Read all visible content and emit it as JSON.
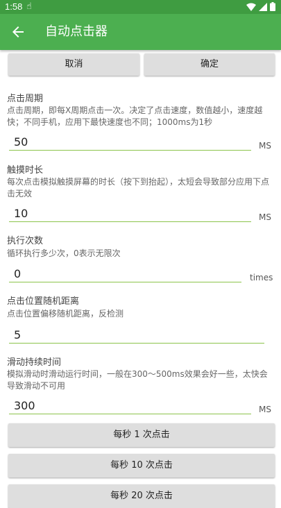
{
  "status": {
    "time": "1:58"
  },
  "appbar": {
    "title": "自动点击器"
  },
  "actions": {
    "cancel": "取消",
    "confirm": "确定"
  },
  "settings": [
    {
      "label": "点击周期",
      "desc": "点击周期，即每X周期点击一次。决定了点击速度，数值越小，速度越快；不同手机，应用下最快速度也不同；1000ms为1秒",
      "value": "50",
      "unit": "MS"
    },
    {
      "label": "触摸时长",
      "desc": "每次点击模拟触摸屏幕的时长（按下到抬起），太短会导致部分应用下点击无效",
      "value": "10",
      "unit": "MS"
    },
    {
      "label": "执行次数",
      "desc": "循环执行多少次，0表示无限次",
      "value": "0",
      "unit": "times"
    },
    {
      "label": "点击位置随机距离",
      "desc": "点击位置偏移随机距离，反检测",
      "value": "5",
      "unit": ""
    },
    {
      "label": "滑动持续时间",
      "desc": "模拟滑动时滑动运行时间，一般在300～500ms效果会好一些，太快会导致滑动不可用",
      "value": "300",
      "unit": "MS"
    }
  ],
  "presets": [
    "每秒 1 次点击",
    "每秒 10 次点击",
    "每秒 20 次点击"
  ],
  "colors": {
    "statusbar": "#3f9c41",
    "appbar": "#4caf50",
    "underline": "#8bc34a"
  }
}
